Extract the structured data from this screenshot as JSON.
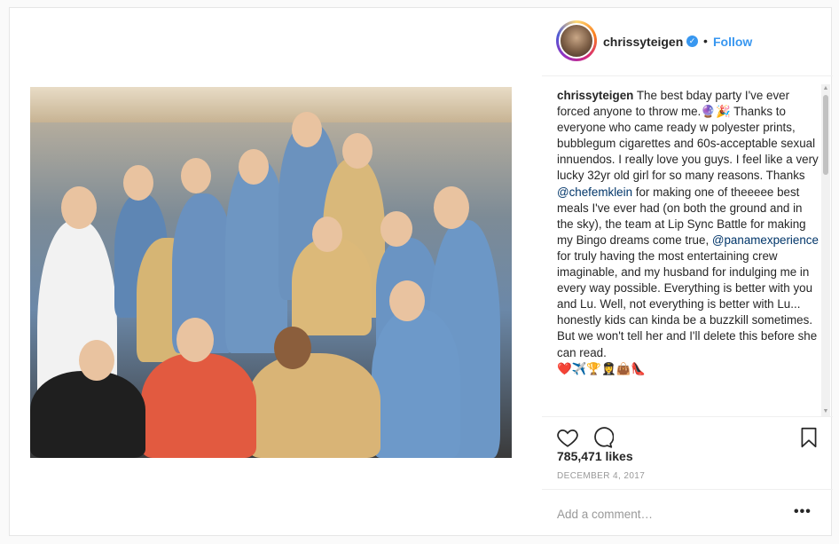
{
  "post": {
    "username": "chrissyteigen",
    "follow_label": "Follow",
    "separator": "•",
    "caption_user": "chrissyteigen",
    "caption_parts": {
      "p1": " The best bday party I've ever forced anyone to throw me.",
      "e1": "🔮🎉",
      "p2": " Thanks to everyone who came ready w polyester prints, bubblegum cigarettes and 60s-acceptable sexual innuendos. I really love you guys. I feel like a very lucky 32yr old girl for so many reasons. Thanks ",
      "m1": "@chefemklein",
      "p3": " for making one of theeeee best meals I've ever had (on both the ground and in the sky), the team at Lip Sync Battle for making my Bingo dreams come true, ",
      "m2": "@panamexperience",
      "p4": " for truly having the most entertaining crew imaginable, and my husband for indulging me in every way possible. Everything is better with you and Lu. Well, not everything is better with Lu... honestly kids can kinda be a buzzkill sometimes. But we won't tell her and I'll delete this before she can read.",
      "e2": "❤️✈️🏆👩‍✈️👜👠"
    },
    "likes": "785,471 likes",
    "date": "DECEMBER 4, 2017",
    "comment_placeholder": "Add a comment…",
    "more_label": "•••",
    "verified_glyph": "✓"
  },
  "icons": {
    "like": "heart-icon",
    "comment": "comment-icon",
    "save": "bookmark-icon",
    "verified": "verified-badge-icon",
    "options": "more-options-icon"
  },
  "colors": {
    "link": "#3897f0",
    "mention": "#003569",
    "text": "#262626",
    "muted": "#999999",
    "border": "#efefef"
  }
}
